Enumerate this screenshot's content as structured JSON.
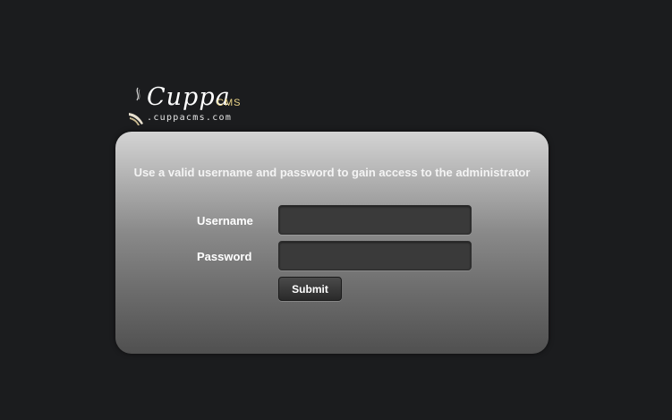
{
  "logo": {
    "brand": "Cuppa",
    "suffix": "CMS",
    "domain": ".cuppacms.com"
  },
  "login": {
    "notice": "Use a valid username and password to gain access to the administrator",
    "username_label": "Username",
    "password_label": "Password",
    "username_value": "",
    "password_value": "",
    "submit_label": "Submit"
  },
  "colors": {
    "background": "#1b1c1e",
    "logo_suffix": "#f0d98a",
    "field_background": "#3a3a3a",
    "button_background": "#2f2f2f"
  }
}
